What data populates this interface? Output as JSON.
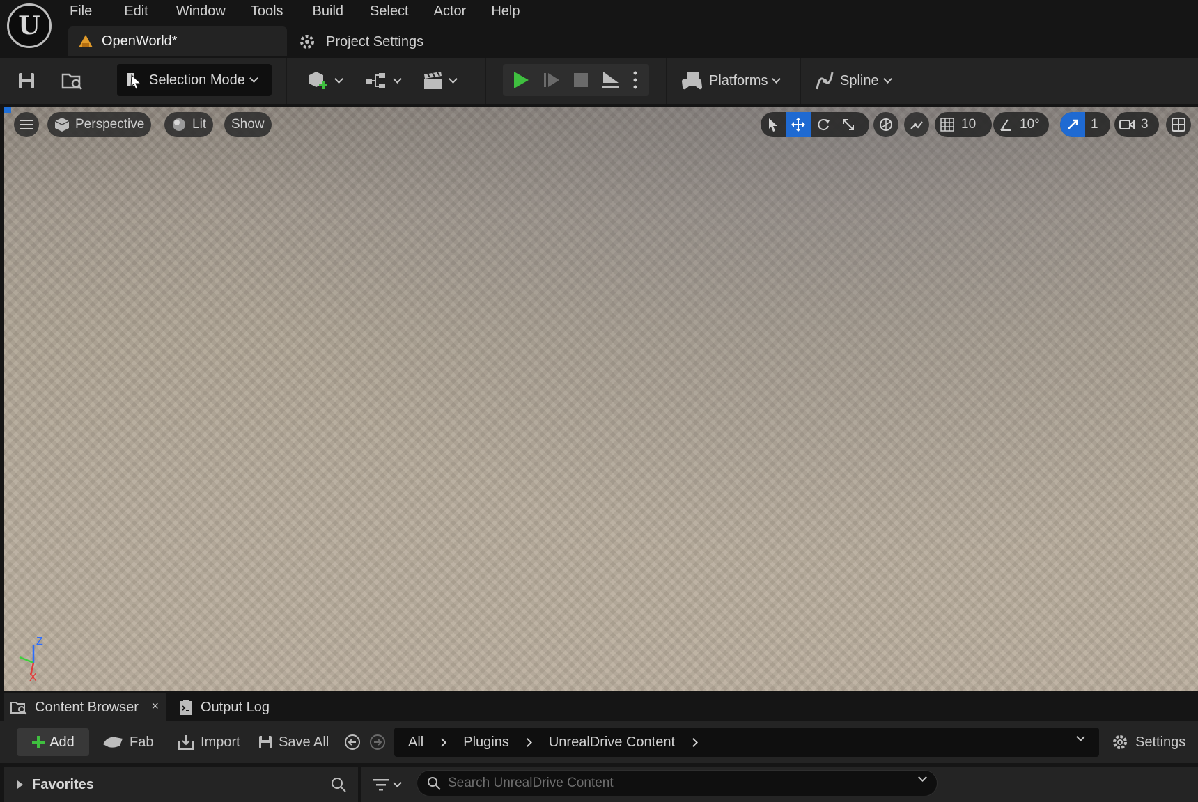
{
  "app": {
    "logo_text": "U"
  },
  "menu": [
    "File",
    "Edit",
    "Window",
    "Tools",
    "Build",
    "Select",
    "Actor",
    "Help"
  ],
  "tabs": {
    "level": "OpenWorld*",
    "project_settings": "Project Settings"
  },
  "toolbar": {
    "selection_mode": "Selection Mode",
    "platforms": "Platforms",
    "spline": "Spline",
    "play_color": "#3fbf3f"
  },
  "viewport": {
    "perspective": "Perspective",
    "lit": "Lit",
    "show": "Show",
    "grid_snap": "10",
    "rotation_snap": "10°",
    "scale_snap": "1",
    "camera_speed": "3",
    "axis_z": "Z",
    "axis_x": "X"
  },
  "content_browser": {
    "tab": "Content Browser",
    "close": "×",
    "output_log": "Output Log",
    "add": "Add",
    "fab": "Fab",
    "import": "Import",
    "save_all": "Save All",
    "breadcrumbs": [
      "All",
      "Plugins",
      "UnrealDrive Content"
    ],
    "settings": "Settings",
    "favorites": "Favorites",
    "search_placeholder": "Search UnrealDrive Content",
    "accent_color": "#1f6ad2"
  }
}
